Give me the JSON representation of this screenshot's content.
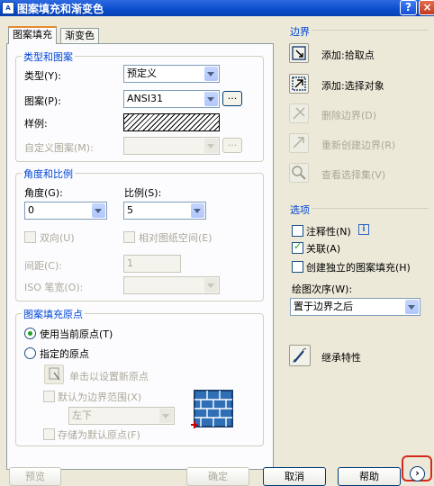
{
  "window": {
    "title": "图案填充和渐变色",
    "icon_text": "A"
  },
  "tabs": [
    {
      "label": "图案填充"
    },
    {
      "label": "渐变色"
    }
  ],
  "type_pattern": {
    "group_title": "类型和图案",
    "type_label": "类型(Y):",
    "type_value": "预定义",
    "pattern_label": "图案(P):",
    "pattern_value": "ANSI31",
    "sample_label": "样例:",
    "custom_label": "自定义图案(M):",
    "ellipsis": "..."
  },
  "angle_scale": {
    "group_title": "角度和比例",
    "angle_label": "角度(G):",
    "angle_value": "0",
    "scale_label": "比例(S):",
    "scale_value": "5",
    "double_label": "双向(U)",
    "relative_label": "相对图纸空间(E)",
    "spacing_label": "间距(C):",
    "spacing_value": "1",
    "iso_label": "ISO 笔宽(O):"
  },
  "origin": {
    "group_title": "图案填充原点",
    "use_current_label": "使用当前原点(T)",
    "specified_label": "指定的原点",
    "click_set_label": "单击以设置新原点",
    "default_extents_label": "默认为边界范围(X)",
    "position_value": "左下",
    "store_default_label": "存储为默认原点(F)"
  },
  "boundaries": {
    "group_title": "边界",
    "add_pick_label": "添加:拾取点",
    "add_select_label": "添加:选择对象",
    "remove_label": "删除边界(D)",
    "recreate_label": "重新创建边界(R)",
    "view_label": "查看选择集(V)"
  },
  "options": {
    "group_title": "选项",
    "annotative_label": "注释性(N)",
    "info_icon_text": "i",
    "associative_label": "关联(A)",
    "separate_label": "创建独立的图案填充(H)",
    "draw_order_label": "绘图次序(W):",
    "draw_order_value": "置于边界之后"
  },
  "inherit": {
    "label": "继承特性"
  },
  "footer": {
    "preview_label": "预览",
    "ok_label": "确定",
    "cancel_label": "取消",
    "help_label": "帮助",
    "more_symbol": "›"
  },
  "controls": {
    "double_checked": false,
    "relative_checked": false,
    "annotative_checked": false,
    "associative_checked": true,
    "separate_checked": false,
    "origin_mode": "use_current"
  }
}
